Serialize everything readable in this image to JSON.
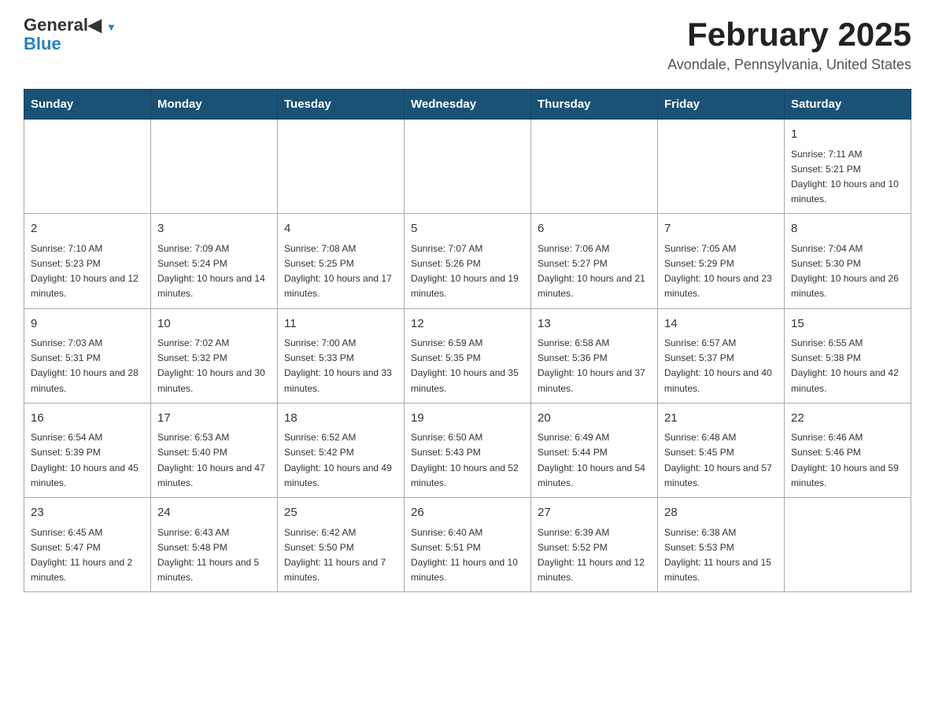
{
  "header": {
    "logo_general": "General",
    "logo_blue": "Blue",
    "title": "February 2025",
    "subtitle": "Avondale, Pennsylvania, United States"
  },
  "weekdays": [
    "Sunday",
    "Monday",
    "Tuesday",
    "Wednesday",
    "Thursday",
    "Friday",
    "Saturday"
  ],
  "weeks": [
    [
      {
        "day": "",
        "info": ""
      },
      {
        "day": "",
        "info": ""
      },
      {
        "day": "",
        "info": ""
      },
      {
        "day": "",
        "info": ""
      },
      {
        "day": "",
        "info": ""
      },
      {
        "day": "",
        "info": ""
      },
      {
        "day": "1",
        "info": "Sunrise: 7:11 AM\nSunset: 5:21 PM\nDaylight: 10 hours and 10 minutes."
      }
    ],
    [
      {
        "day": "2",
        "info": "Sunrise: 7:10 AM\nSunset: 5:23 PM\nDaylight: 10 hours and 12 minutes."
      },
      {
        "day": "3",
        "info": "Sunrise: 7:09 AM\nSunset: 5:24 PM\nDaylight: 10 hours and 14 minutes."
      },
      {
        "day": "4",
        "info": "Sunrise: 7:08 AM\nSunset: 5:25 PM\nDaylight: 10 hours and 17 minutes."
      },
      {
        "day": "5",
        "info": "Sunrise: 7:07 AM\nSunset: 5:26 PM\nDaylight: 10 hours and 19 minutes."
      },
      {
        "day": "6",
        "info": "Sunrise: 7:06 AM\nSunset: 5:27 PM\nDaylight: 10 hours and 21 minutes."
      },
      {
        "day": "7",
        "info": "Sunrise: 7:05 AM\nSunset: 5:29 PM\nDaylight: 10 hours and 23 minutes."
      },
      {
        "day": "8",
        "info": "Sunrise: 7:04 AM\nSunset: 5:30 PM\nDaylight: 10 hours and 26 minutes."
      }
    ],
    [
      {
        "day": "9",
        "info": "Sunrise: 7:03 AM\nSunset: 5:31 PM\nDaylight: 10 hours and 28 minutes."
      },
      {
        "day": "10",
        "info": "Sunrise: 7:02 AM\nSunset: 5:32 PM\nDaylight: 10 hours and 30 minutes."
      },
      {
        "day": "11",
        "info": "Sunrise: 7:00 AM\nSunset: 5:33 PM\nDaylight: 10 hours and 33 minutes."
      },
      {
        "day": "12",
        "info": "Sunrise: 6:59 AM\nSunset: 5:35 PM\nDaylight: 10 hours and 35 minutes."
      },
      {
        "day": "13",
        "info": "Sunrise: 6:58 AM\nSunset: 5:36 PM\nDaylight: 10 hours and 37 minutes."
      },
      {
        "day": "14",
        "info": "Sunrise: 6:57 AM\nSunset: 5:37 PM\nDaylight: 10 hours and 40 minutes."
      },
      {
        "day": "15",
        "info": "Sunrise: 6:55 AM\nSunset: 5:38 PM\nDaylight: 10 hours and 42 minutes."
      }
    ],
    [
      {
        "day": "16",
        "info": "Sunrise: 6:54 AM\nSunset: 5:39 PM\nDaylight: 10 hours and 45 minutes."
      },
      {
        "day": "17",
        "info": "Sunrise: 6:53 AM\nSunset: 5:40 PM\nDaylight: 10 hours and 47 minutes."
      },
      {
        "day": "18",
        "info": "Sunrise: 6:52 AM\nSunset: 5:42 PM\nDaylight: 10 hours and 49 minutes."
      },
      {
        "day": "19",
        "info": "Sunrise: 6:50 AM\nSunset: 5:43 PM\nDaylight: 10 hours and 52 minutes."
      },
      {
        "day": "20",
        "info": "Sunrise: 6:49 AM\nSunset: 5:44 PM\nDaylight: 10 hours and 54 minutes."
      },
      {
        "day": "21",
        "info": "Sunrise: 6:48 AM\nSunset: 5:45 PM\nDaylight: 10 hours and 57 minutes."
      },
      {
        "day": "22",
        "info": "Sunrise: 6:46 AM\nSunset: 5:46 PM\nDaylight: 10 hours and 59 minutes."
      }
    ],
    [
      {
        "day": "23",
        "info": "Sunrise: 6:45 AM\nSunset: 5:47 PM\nDaylight: 11 hours and 2 minutes."
      },
      {
        "day": "24",
        "info": "Sunrise: 6:43 AM\nSunset: 5:48 PM\nDaylight: 11 hours and 5 minutes."
      },
      {
        "day": "25",
        "info": "Sunrise: 6:42 AM\nSunset: 5:50 PM\nDaylight: 11 hours and 7 minutes."
      },
      {
        "day": "26",
        "info": "Sunrise: 6:40 AM\nSunset: 5:51 PM\nDaylight: 11 hours and 10 minutes."
      },
      {
        "day": "27",
        "info": "Sunrise: 6:39 AM\nSunset: 5:52 PM\nDaylight: 11 hours and 12 minutes."
      },
      {
        "day": "28",
        "info": "Sunrise: 6:38 AM\nSunset: 5:53 PM\nDaylight: 11 hours and 15 minutes."
      },
      {
        "day": "",
        "info": ""
      }
    ]
  ]
}
